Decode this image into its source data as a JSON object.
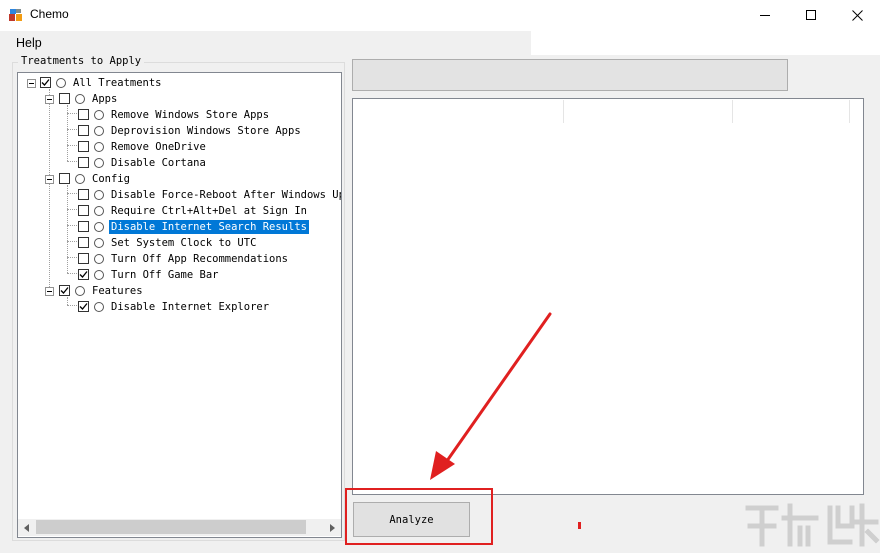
{
  "window": {
    "title": "Chemo",
    "controls": {
      "minimize": "minimize-icon",
      "maximize": "maximize-icon",
      "close": "close-icon"
    }
  },
  "menu": {
    "help": "Help"
  },
  "treatments": {
    "group_label": "Treatments to Apply",
    "items": [
      {
        "label": "All Treatments",
        "checked": true
      },
      {
        "label": "Apps",
        "checked": false
      },
      {
        "label": "Remove Windows Store Apps",
        "checked": false
      },
      {
        "label": "Deprovision Windows Store Apps",
        "checked": false
      },
      {
        "label": "Remove OneDrive",
        "checked": false
      },
      {
        "label": "Disable Cortana",
        "checked": false
      },
      {
        "label": "Config",
        "checked": false
      },
      {
        "label": "Disable Force-Reboot After Windows Upd",
        "checked": false
      },
      {
        "label": "Require Ctrl+Alt+Del at Sign In",
        "checked": false
      },
      {
        "label": "Disable Internet Search Results",
        "checked": false,
        "selected": true
      },
      {
        "label": "Set System Clock to UTC",
        "checked": false
      },
      {
        "label": "Turn Off App Recommendations",
        "checked": false
      },
      {
        "label": "Turn Off Game Bar",
        "checked": true
      },
      {
        "label": "Features",
        "checked": true
      },
      {
        "label": "Disable Internet Explorer",
        "checked": true
      }
    ]
  },
  "actions": {
    "analyze": "Analyze"
  },
  "colors": {
    "selection": "#0078d7",
    "annotation": "#e02020"
  }
}
